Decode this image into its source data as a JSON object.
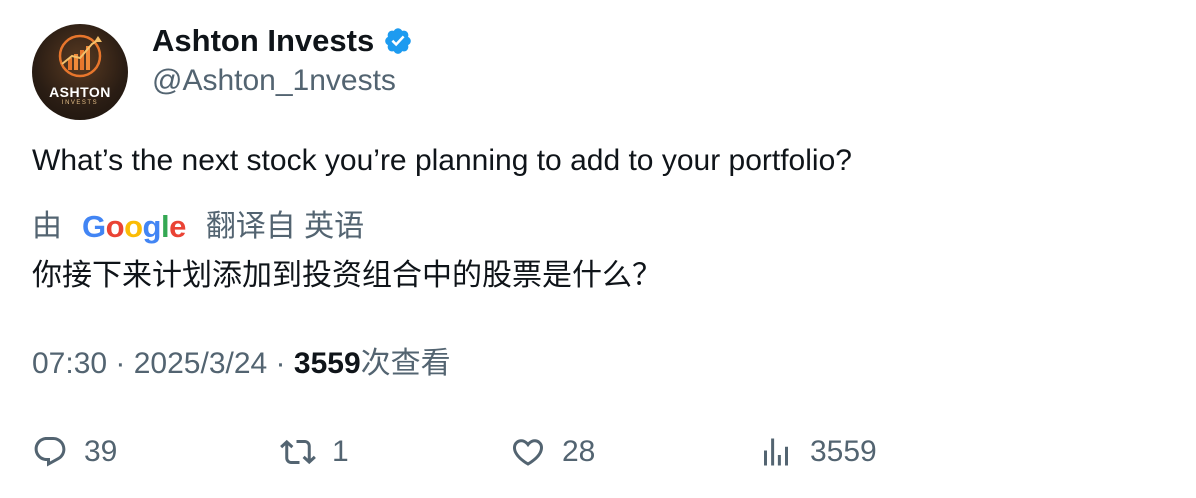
{
  "author": {
    "name": "Ashton Invests",
    "handle": "@Ashton_1nvests",
    "avatar_brand": "ASHTON",
    "avatar_sub": "INVESTS",
    "verified_color": "#1d9bf0"
  },
  "tweet": {
    "text": "What’s the next stock you’re planning to add to your portfolio?"
  },
  "translation": {
    "by_label": "由",
    "provider": "Google",
    "from_label": "翻译自 英语",
    "translated_text": "你接下来计划添加到投资组合中的股票是什么？"
  },
  "meta": {
    "time": "07:30",
    "separator1": " · ",
    "date": "2025/3/24",
    "separator2": " · ",
    "views_count": "3559",
    "views_label": "次查看"
  },
  "actions": {
    "reply_count": "39",
    "retweet_count": "1",
    "like_count": "28",
    "views_count": "3559",
    "icons": [
      "reply-icon",
      "retweet-icon",
      "like-icon",
      "views-icon"
    ]
  },
  "colors": {
    "text_primary": "#0f1419",
    "text_secondary": "#536471",
    "google_blue": "#4285f4",
    "google_red": "#ea4335",
    "google_yellow": "#fbbc05",
    "google_green": "#34a853"
  }
}
